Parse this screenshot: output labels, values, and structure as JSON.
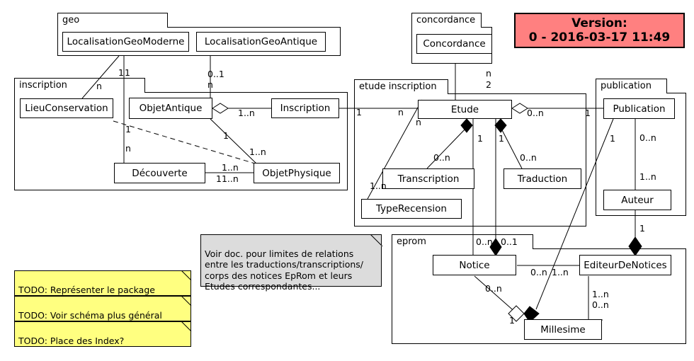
{
  "diagram": {
    "title": "UML package / class diagram",
    "background": "#ffffff",
    "line_color": "#000000"
  },
  "version_badge": {
    "line1": "Version:",
    "line2": "0 - 2016-03-17 11:49",
    "color": "#ff8080"
  },
  "packages": [
    {
      "id": "geo",
      "label": "geo"
    },
    {
      "id": "inscription",
      "label": "inscription"
    },
    {
      "id": "concordance",
      "label": "concordance"
    },
    {
      "id": "etude_inscription",
      "label": "etude inscription"
    },
    {
      "id": "publication",
      "label": "publication"
    },
    {
      "id": "eprom",
      "label": "eprom"
    }
  ],
  "classes": [
    {
      "id": "localisationgeomoderne",
      "label": "LocalisationGeoModerne",
      "package": "geo"
    },
    {
      "id": "localisationgeoantique",
      "label": "LocalisationGeoAntique",
      "package": "geo"
    },
    {
      "id": "lieuconservation",
      "label": "LieuConservation",
      "package": "inscription"
    },
    {
      "id": "objetantique",
      "label": "ObjetAntique",
      "package": "inscription"
    },
    {
      "id": "inscription_class",
      "label": "Inscription",
      "package": "inscription"
    },
    {
      "id": "decouverte",
      "label": "Découverte",
      "package": "inscription"
    },
    {
      "id": "objetphysique",
      "label": "ObjetPhysique",
      "package": "inscription"
    },
    {
      "id": "concordance_class",
      "label": "Concordance",
      "package": "concordance"
    },
    {
      "id": "etude",
      "label": "Etude",
      "package": "etude_inscription"
    },
    {
      "id": "transcription",
      "label": "Transcription",
      "package": "etude_inscription"
    },
    {
      "id": "traduction",
      "label": "Traduction",
      "package": "etude_inscription"
    },
    {
      "id": "typerecension",
      "label": "TypeRecension",
      "package": "etude_inscription"
    },
    {
      "id": "publication_class",
      "label": "Publication",
      "package": "publication"
    },
    {
      "id": "auteur",
      "label": "Auteur",
      "package": "publication"
    },
    {
      "id": "notice",
      "label": "Notice",
      "package": "eprom"
    },
    {
      "id": "editeurdenotices",
      "label": "EditeurDeNotices",
      "package": "eprom"
    },
    {
      "id": "millesime",
      "label": "Millesime",
      "package": "eprom"
    }
  ],
  "multiplicities": [
    {
      "id": "m01",
      "text": "1",
      "note": "LocalisationGeoModerne - LieuConservation (near moderne)"
    },
    {
      "id": "m02",
      "text": "1",
      "note": "LocalisationGeoModerne - Decouverte"
    },
    {
      "id": "m03",
      "text": "n",
      "note": "LieuConservation side"
    },
    {
      "id": "m04",
      "text": "0..1",
      "note": "LocalisationGeoAntique - ObjetAntique"
    },
    {
      "id": "m05",
      "text": "n",
      "note": "ObjetAntique side of geo antique link"
    },
    {
      "id": "m06",
      "text": "1..n",
      "note": "ObjetAntique aggregation - Inscription"
    },
    {
      "id": "m07",
      "text": "1",
      "note": "LieuConservation - Decouverte (vertical)"
    },
    {
      "id": "m08",
      "text": "n",
      "note": "Decouverte side"
    },
    {
      "id": "m09",
      "text": "1",
      "note": "ObjetAntique - ObjetPhysique near ObjetAntique"
    },
    {
      "id": "m10",
      "text": "1..n",
      "note": "ObjetAntique - ObjetPhysique near ObjetPhysique"
    },
    {
      "id": "m11",
      "text": "1..n",
      "note": "Decouverte - ObjetPhysique upper"
    },
    {
      "id": "m12",
      "text": "11..n",
      "note": "Decouverte - ObjetPhysique lower"
    },
    {
      "id": "m13",
      "text": "n",
      "note": "Concordance - Etude near Concordance"
    },
    {
      "id": "m14",
      "text": "2",
      "note": "Concordance - Etude near Etude"
    },
    {
      "id": "m15",
      "text": "1",
      "note": "Inscription - Etude near Inscription"
    },
    {
      "id": "m16",
      "text": "n",
      "note": "Inscription - Etude near Etude"
    },
    {
      "id": "m17",
      "text": "n",
      "note": "Etude - TypeRecension near Etude"
    },
    {
      "id": "m18",
      "text": "1..n",
      "note": "Etude - TypeRecension near TypeRecension"
    },
    {
      "id": "m19",
      "text": "1",
      "note": "Etude composition - Transcription near Etude"
    },
    {
      "id": "m20",
      "text": "0..n",
      "note": "Etude composition - Transcription near Transcription"
    },
    {
      "id": "m21",
      "text": "1",
      "note": "Etude composition - Traduction near Etude"
    },
    {
      "id": "m22",
      "text": "0..n",
      "note": "Etude composition - Traduction near Traduction"
    },
    {
      "id": "m23",
      "text": "0..n",
      "note": "Etude aggregation - Publication near Etude"
    },
    {
      "id": "m24",
      "text": "1",
      "note": "Etude - Publication near Publication"
    },
    {
      "id": "m25",
      "text": "0..n",
      "note": "Publication - Auteur near Publication"
    },
    {
      "id": "m26",
      "text": "1..n",
      "note": "Publication - Auteur near Auteur"
    },
    {
      "id": "m27",
      "text": "1",
      "note": "Publication - Millesime near Publication"
    },
    {
      "id": "m28",
      "text": "1",
      "note": "Auteur - EditeurDeNotices near Auteur"
    },
    {
      "id": "m29",
      "text": "0..n",
      "note": "Etude - Notice near Notice"
    },
    {
      "id": "m30",
      "text": "0..1",
      "note": "Etude - Notice second"
    },
    {
      "id": "m31",
      "text": "0..n",
      "note": "Notice - EditeurDeNotices near Notice"
    },
    {
      "id": "m32",
      "text": "1..n",
      "note": "Notice - EditeurDeNotices near Editeur"
    },
    {
      "id": "m33",
      "text": "0..n",
      "note": "Notice - Millesime near Notice"
    },
    {
      "id": "m34",
      "text": "1",
      "note": "Notice - Millesime near Millesime"
    },
    {
      "id": "m35",
      "text": "1..n",
      "note": "EditeurDeNotices - Millesime upper"
    },
    {
      "id": "m36",
      "text": "0..n",
      "note": "EditeurDeNotices - Millesime lower"
    }
  ],
  "notes": [
    {
      "id": "note-doc",
      "style": "gray",
      "text": "Voir doc. pour limites de relations\nentre les traductions/transcriptions/\ncorps des notices EpRom et leurs\nEtudes correspondantes..."
    },
    {
      "id": "todo-1",
      "style": "yellow",
      "text": "TODO: Représenter le package\n'application'?"
    },
    {
      "id": "todo-2",
      "style": "yellow",
      "text": "TODO: Voir schéma plus général\n(Publi. / Inscr. / Hist.)?"
    },
    {
      "id": "todo-3",
      "style": "yellow",
      "text": "TODO: Place des Index?"
    }
  ]
}
